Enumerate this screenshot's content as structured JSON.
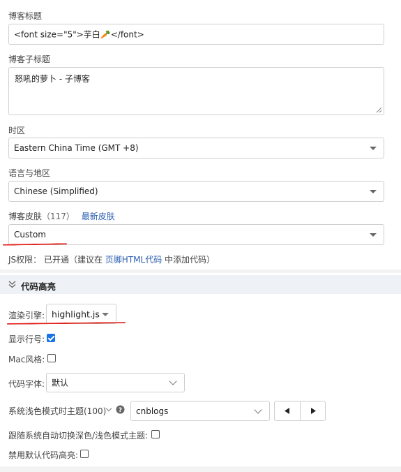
{
  "blog_title": {
    "label": "博客标题",
    "value": "<font size=\"5\">芋白🥕</font>"
  },
  "blog_subtitle": {
    "label": "博客子标题",
    "value": "怒吼的萝卜 - 子博客"
  },
  "timezone": {
    "label": "时区",
    "value": "Eastern China Time (GMT +8)"
  },
  "language": {
    "label": "语言与地区",
    "value": "Chinese (Simplified)"
  },
  "skin": {
    "label": "博客皮肤",
    "count": "（117）",
    "newest_link": "最新皮肤",
    "value": "Custom"
  },
  "js_permission": {
    "prefix": "JS权限：  已开通（建议在 ",
    "link": "页脚HTML代码",
    "suffix": " 中添加代码）"
  },
  "code_highlight": {
    "section_title": "代码高亮",
    "engine_label": "渲染引擎:",
    "engine_value": "highlight.js",
    "line_numbers_label": "显示行号:",
    "line_numbers_checked": true,
    "mac_style_label": "Mac风格:",
    "mac_style_checked": false,
    "font_label": "代码字体:",
    "font_value": "默认",
    "light_theme_label": "系统浅色模式时主题(100)",
    "light_theme_value": "cnblogs",
    "auto_switch_label": "跟随系统自动切换深色/浅色模式主题:",
    "auto_switch_checked": false,
    "disable_default_label": "禁用默认代码高亮:",
    "disable_default_checked": false
  },
  "colors": {
    "accent": "#1a73e8",
    "link": "#2a5db0",
    "annotation": "#e0201a",
    "section_band": "#eef1f5"
  }
}
